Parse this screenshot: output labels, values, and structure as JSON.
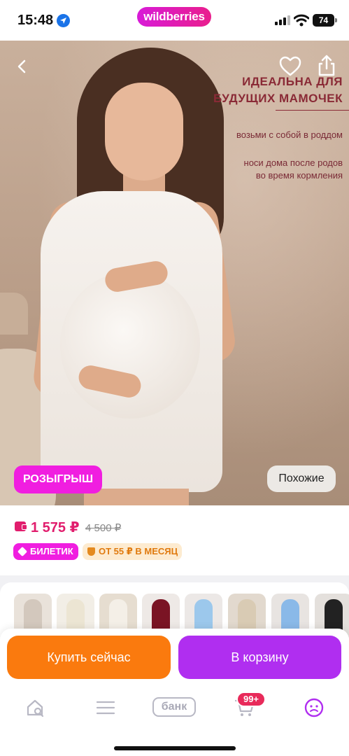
{
  "status_bar": {
    "time": "15:48",
    "battery": "74",
    "app_logo": "wildberries"
  },
  "hero": {
    "heading_line1": "ИДЕАЛЬНА ДЛЯ",
    "heading_line2": "БУДУЩИХ МАМОЧЕК",
    "note1": "возьми с собой в роддом",
    "note2_line1": "носи дома после родов",
    "note2_line2": "во время кормления",
    "raffle_label": "РОЗЫГРЫШ",
    "similar_label": "Похожие",
    "icons": [
      "chevron-left-icon",
      "heart-icon",
      "share-icon"
    ]
  },
  "price": {
    "current": "1 575 ₽",
    "old": "4 500 ₽",
    "ticket_label": "БИЛЕТИК",
    "installment_label": "ОТ 55 ₽ В МЕСЯЦ"
  },
  "actions": {
    "buy_now": "Купить сейчас",
    "add_to_cart": "В корзину"
  },
  "nav": {
    "bank_label": "банк",
    "cart_count": "99+"
  },
  "colors": {
    "brand_pink": "#f01ee0",
    "price_red": "#e11d6d",
    "buy_orange": "#fa7a0e",
    "cart_purple": "#b02ef0"
  }
}
